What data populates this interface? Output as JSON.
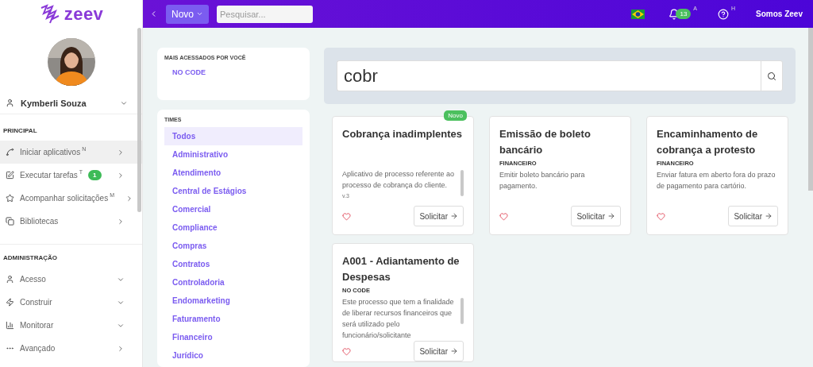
{
  "brand": {
    "name": "zeev"
  },
  "topbar": {
    "new_button": "Novo",
    "search": {
      "placeholder": "Pesquisar..."
    },
    "notifications": {
      "count": "13",
      "shortcut": "A"
    },
    "help": {
      "shortcut": "H"
    },
    "company": "Somos Zeev"
  },
  "sidebar": {
    "user": {
      "name": "Kymberli Souza"
    },
    "sections": [
      {
        "title": "PRINCIPAL",
        "items": [
          {
            "label": "Iniciar aplicativos",
            "shortcut": "N",
            "kind": "link",
            "selected": true
          },
          {
            "label": "Executar tarefas",
            "shortcut": "T",
            "badge": "1",
            "kind": "link",
            "selected": false
          },
          {
            "label": "Acompanhar solicitações",
            "shortcut": "M",
            "kind": "link",
            "selected": false
          },
          {
            "label": "Bibliotecas",
            "kind": "link",
            "selected": false
          }
        ]
      },
      {
        "title": "ADMINISTRAÇÃO",
        "items": [
          {
            "label": "Acesso",
            "kind": "group",
            "selected": false
          },
          {
            "label": "Construir",
            "kind": "group",
            "selected": false
          },
          {
            "label": "Monitorar",
            "kind": "group",
            "selected": false
          },
          {
            "label": "Avançado",
            "kind": "link",
            "selected": false
          }
        ]
      }
    ]
  },
  "most_accessed": {
    "title": "MAIS ACESSADOS POR VOCÊ",
    "items": [
      "NO CODE"
    ]
  },
  "teams": {
    "title": "TIMES",
    "items": [
      {
        "label": "Todos",
        "selected": true
      },
      {
        "label": "Administrativo",
        "selected": false
      },
      {
        "label": "Atendimento",
        "selected": false
      },
      {
        "label": "Central de Estágios",
        "selected": false
      },
      {
        "label": "Comercial",
        "selected": false
      },
      {
        "label": "Compliance",
        "selected": false
      },
      {
        "label": "Compras",
        "selected": false
      },
      {
        "label": "Contratos",
        "selected": false
      },
      {
        "label": "Controladoria",
        "selected": false
      },
      {
        "label": "Endomarketing",
        "selected": false
      },
      {
        "label": "Faturamento",
        "selected": false
      },
      {
        "label": "Financeiro",
        "selected": false
      },
      {
        "label": "Jurídico",
        "selected": false
      }
    ]
  },
  "search": {
    "value": "cobr"
  },
  "apps": [
    {
      "title": "Cobrança inadimplentes",
      "badge": "Novo",
      "description": "Aplicativo de processo referente ao processo de cobrança do cliente.",
      "version": "v.3",
      "scrollable": true,
      "action": "Solicitar"
    },
    {
      "title": "Emissão de boleto bancário",
      "category": "FINANCEIRO",
      "description": "Emitir boleto bancário para pagamento.",
      "scrollable": false,
      "action": "Solicitar"
    },
    {
      "title": "Encaminhamento de cobrança a protesto",
      "category": "FINANCEIRO",
      "description": "Enviar fatura em aberto fora do prazo de pagamento para cartório.",
      "scrollable": false,
      "action": "Solicitar"
    },
    {
      "title": "A001 - Adiantamento de Despesas",
      "category": "NO CODE",
      "description": "Este processo que tem a finalidade de liberar recursos financeiros que será utilizado pelo funcionário/solicitante",
      "scrollable": true,
      "action": "Solicitar"
    }
  ]
}
